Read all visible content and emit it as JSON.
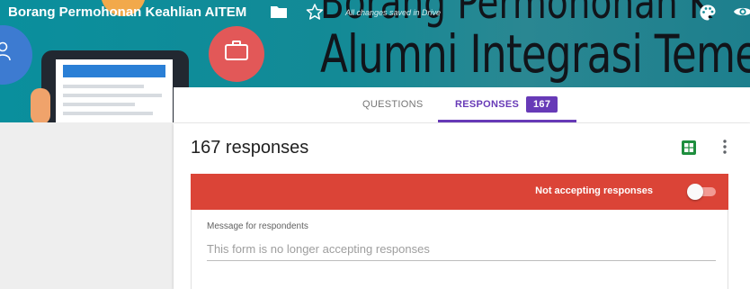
{
  "header": {
    "form_title": "Borang Permohonan Keahlian AITEM",
    "save_status": "All changes saved in Drive",
    "banner_text": "Alumni Integrasi Teme",
    "banner_text_top": "Borang Permohonan K",
    "icons": {
      "folder": "folder-icon",
      "star": "star-icon",
      "palette": "palette-icon",
      "preview": "eye-icon"
    }
  },
  "tabs": [
    {
      "label": "QUESTIONS",
      "active": false
    },
    {
      "label": "RESPONSES",
      "active": true,
      "badge": "167"
    }
  ],
  "responses": {
    "count_label": "167 responses",
    "accepting_label": "Not accepting responses",
    "accepting": false,
    "message_label": "Message for respondents",
    "message_placeholder": "This form is no longer accepting responses"
  },
  "colors": {
    "accent": "#673ab7",
    "banner": "#db4437",
    "sheets": "#1e8e3e",
    "header_teal": "#0a8f9d"
  }
}
